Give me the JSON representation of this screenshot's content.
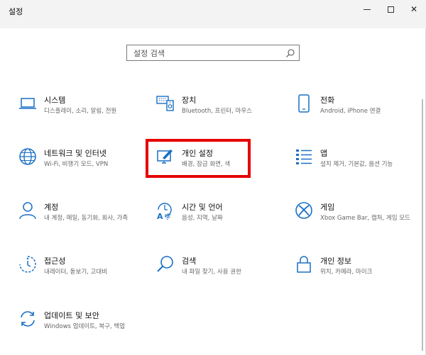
{
  "window": {
    "title": "설정",
    "min_label": "—",
    "close_label": "✕"
  },
  "search": {
    "placeholder": "설정 검색",
    "icon": "search-icon"
  },
  "accent_color": "#1a6fc4",
  "highlight_color": "#e60000",
  "tiles": [
    {
      "title": "시스템",
      "desc": "디스플레이, 소리, 알림, 전원",
      "icon": "laptop-icon"
    },
    {
      "title": "장치",
      "desc": "Bluetooth, 프린터, 마우스",
      "icon": "keyboard-icon"
    },
    {
      "title": "전화",
      "desc": "Android, iPhone 연결",
      "icon": "phone-icon"
    },
    {
      "title": "네트워크 및 인터넷",
      "desc": "Wi-Fi, 비행기 모드, VPN",
      "icon": "globe-icon"
    },
    {
      "title": "개인 설정",
      "desc": "배경, 잠금 화면, 색",
      "icon": "personalization-icon"
    },
    {
      "title": "앱",
      "desc": "설치 제거, 기본값, 옵션 기능",
      "icon": "apps-list-icon"
    },
    {
      "title": "계정",
      "desc": "내 계정, 메일, 동기화, 회사, 가족",
      "icon": "person-icon"
    },
    {
      "title": "시간 및 언어",
      "desc": "음성, 지역, 날짜",
      "icon": "time-language-icon"
    },
    {
      "title": "게임",
      "desc": "Xbox Game Bar, 캡처, 게임 모드",
      "icon": "xbox-icon"
    },
    {
      "title": "접근성",
      "desc": "내레이터, 돋보기, 고대비",
      "icon": "accessibility-icon"
    },
    {
      "title": "검색",
      "desc": "내 파일 찾기, 사용 권한",
      "icon": "search-magnifier-icon"
    },
    {
      "title": "개인 정보",
      "desc": "위치, 카메라, 마이크",
      "icon": "lock-icon"
    },
    {
      "title": "업데이트 및 보안",
      "desc": "Windows 업데이트, 복구, 백업",
      "icon": "update-icon"
    }
  ]
}
